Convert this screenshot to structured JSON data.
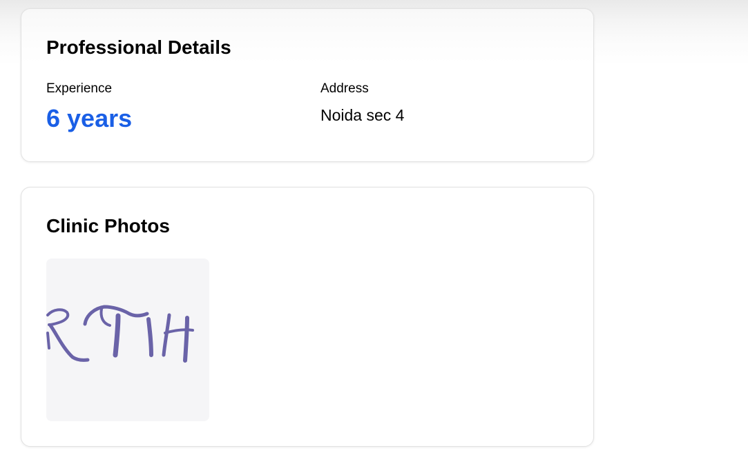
{
  "professional": {
    "title": "Professional Details",
    "experience_label": "Experience",
    "experience_value": "6 years",
    "address_label": "Address",
    "address_value": "Noida sec 4"
  },
  "photos": {
    "title": "Clinic Photos",
    "items": [
      {
        "content": "handwritten signature image"
      }
    ]
  },
  "colors": {
    "accent": "#1a5fe6",
    "signature_ink": "#6a63a8",
    "card_border": "#e1e1e1",
    "photo_bg": "#f5f5f7"
  }
}
